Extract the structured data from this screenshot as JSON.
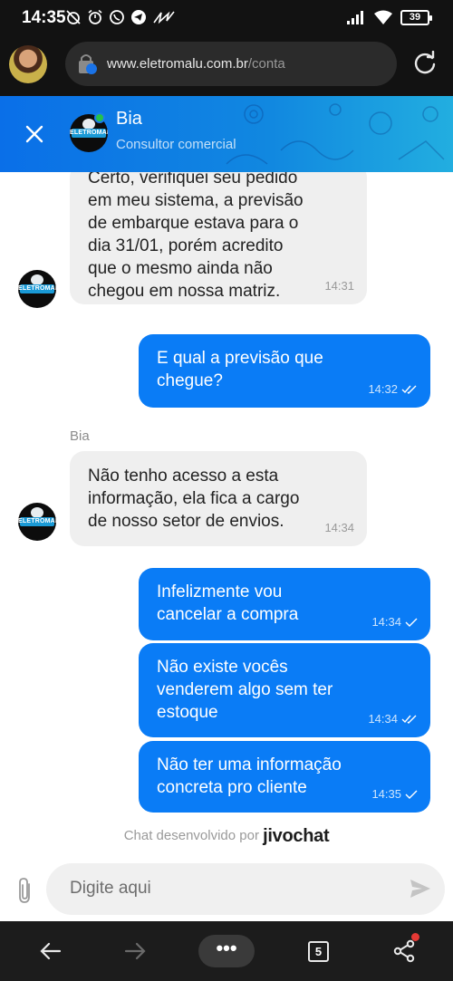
{
  "status_bar": {
    "time": "14:35",
    "battery": "39"
  },
  "browser": {
    "url_domain": "www.eletromalu.com.br",
    "url_path": "/conta"
  },
  "chat_header": {
    "agent_name": "Bia",
    "agent_role": "Consultor comercial",
    "online": true,
    "accent_color": "#0a7cf6"
  },
  "logo_text": "ELETROMALU",
  "messages": [
    {
      "direction": "in",
      "text": "Certo, verifiquei seu pedido\nem meu sistema, a previsão\nde embarque estava para o\ndia 31/01, porém acredito\nque o mesmo ainda não\nchegou em nossa matriz.",
      "time": "14:31"
    },
    {
      "direction": "out",
      "text": "E qual a previsão que\nchegue?",
      "time": "14:32",
      "status": "read"
    },
    {
      "direction": "in",
      "sender": "Bia",
      "text": "Não tenho acesso a esta\ninformação, ela fica a cargo\nde nosso setor de envios.",
      "time": "14:34"
    },
    {
      "direction": "out",
      "text": "Infelizmente vou\ncancelar a compra",
      "time": "14:34",
      "status": "sent"
    },
    {
      "direction": "out",
      "text": "Não existe vocês\nvenderem algo sem ter\nestoque",
      "time": "14:34",
      "status": "read"
    },
    {
      "direction": "out",
      "text": "Não ter uma informação\nconcreta pro cliente",
      "time": "14:35",
      "status": "sent"
    }
  ],
  "powered_by": {
    "prefix": "Chat desenvolvido por",
    "brand": "jivochat"
  },
  "composer": {
    "placeholder": "Digite aqui"
  },
  "bottom_nav": {
    "menu_label": "•••",
    "tab_count": "5"
  }
}
